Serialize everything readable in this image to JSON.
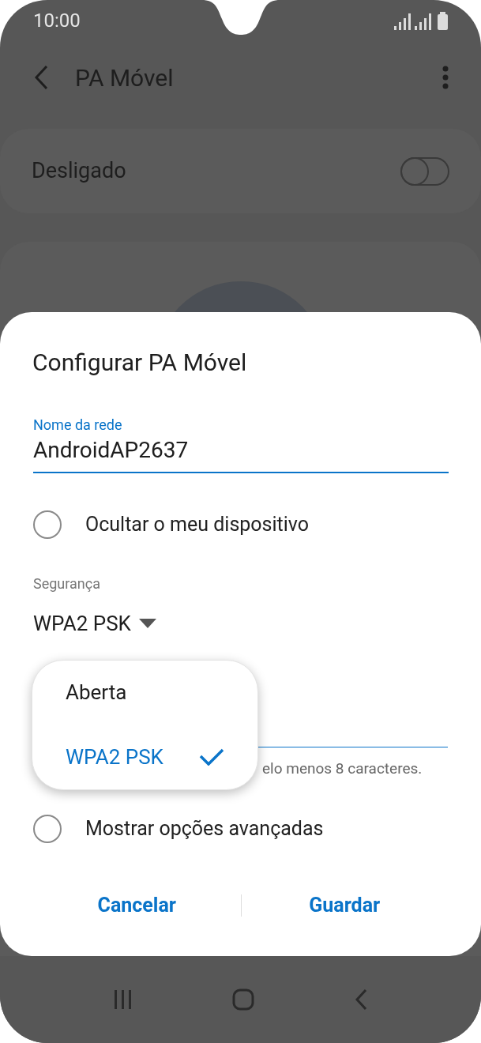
{
  "status_bar": {
    "time": "10:00"
  },
  "app_bar": {
    "title": "PA Móvel"
  },
  "hotspot_switch": {
    "label": "Desligado",
    "on": false
  },
  "dialog": {
    "title": "Configurar PA Móvel",
    "network_name": {
      "label": "Nome da rede",
      "value": "AndroidAP2637"
    },
    "hide_device": {
      "label": "Ocultar o meu dispositivo",
      "checked": false
    },
    "security": {
      "label": "Segurança",
      "value": "WPA2 PSK"
    },
    "password_hint": "elo menos 8 caracteres.",
    "advanced": {
      "label": "Mostrar opções avançadas",
      "checked": false
    },
    "buttons": [
      "Cancelar",
      "Guardar"
    ]
  },
  "security_menu": [
    {
      "label": "Aberta",
      "selected": false
    },
    {
      "label": "WPA2 PSK",
      "selected": true
    }
  ]
}
